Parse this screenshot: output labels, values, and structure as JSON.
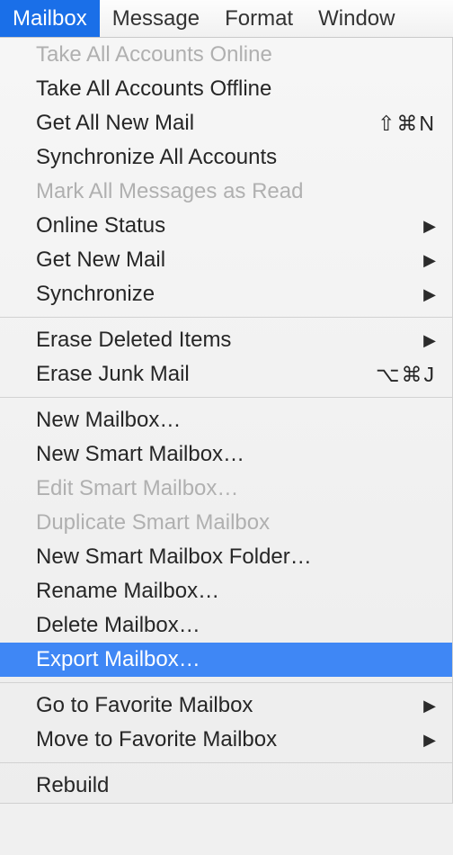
{
  "menubar": {
    "items": [
      {
        "label": "Mailbox",
        "active": true
      },
      {
        "label": "Message",
        "active": false
      },
      {
        "label": "Format",
        "active": false
      },
      {
        "label": "Window",
        "active": false
      }
    ]
  },
  "menu": {
    "sections": [
      [
        {
          "label": "Take All Accounts Online",
          "disabled": true
        },
        {
          "label": "Take All Accounts Offline"
        },
        {
          "label": "Get All New Mail",
          "shortcut": "⇧⌘N"
        },
        {
          "label": "Synchronize All Accounts"
        },
        {
          "label": "Mark All Messages as Read",
          "disabled": true
        },
        {
          "label": "Online Status",
          "submenu": true
        },
        {
          "label": "Get New Mail",
          "submenu": true
        },
        {
          "label": "Synchronize",
          "submenu": true
        }
      ],
      [
        {
          "label": "Erase Deleted Items",
          "submenu": true
        },
        {
          "label": "Erase Junk Mail",
          "shortcut": "⌥⌘J"
        }
      ],
      [
        {
          "label": "New Mailbox…"
        },
        {
          "label": "New Smart Mailbox…"
        },
        {
          "label": "Edit Smart Mailbox…",
          "disabled": true
        },
        {
          "label": "Duplicate Smart Mailbox",
          "disabled": true
        },
        {
          "label": "New Smart Mailbox Folder…"
        },
        {
          "label": "Rename Mailbox…"
        },
        {
          "label": "Delete Mailbox…"
        },
        {
          "label": "Export Mailbox…",
          "highlighted": true
        }
      ],
      [
        {
          "label": "Go to Favorite Mailbox",
          "submenu": true
        },
        {
          "label": "Move to Favorite Mailbox",
          "submenu": true
        }
      ],
      [
        {
          "label": "Rebuild"
        }
      ]
    ]
  }
}
